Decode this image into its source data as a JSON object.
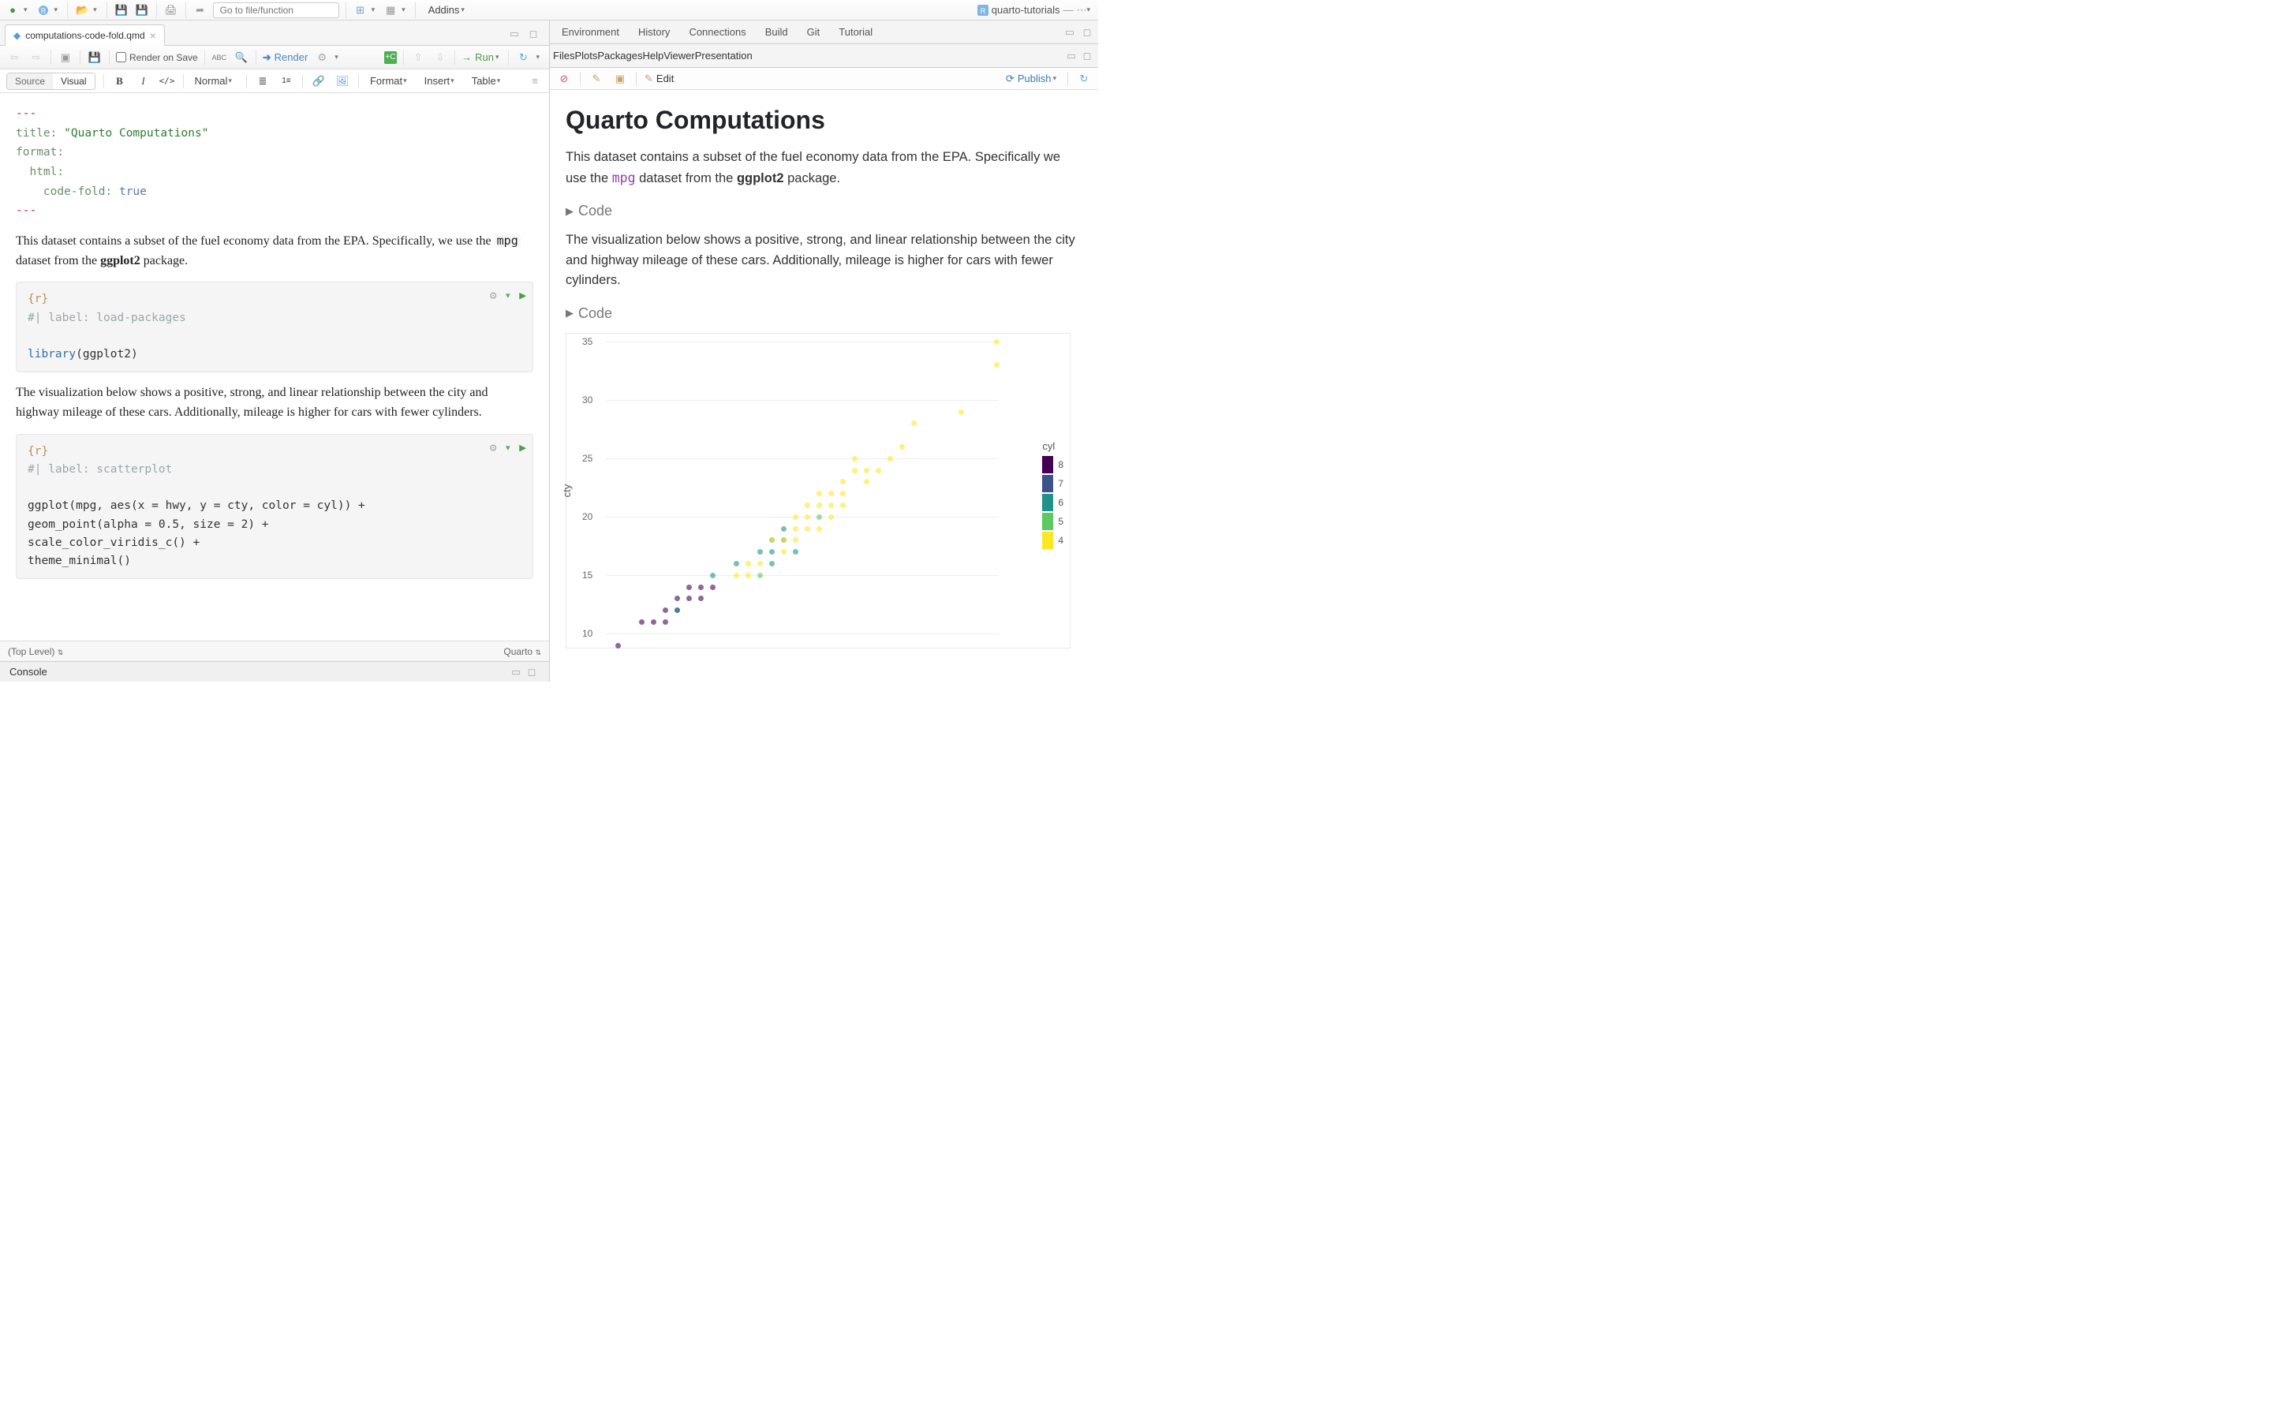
{
  "topbar": {
    "goto_placeholder": "Go to file/function",
    "addins_label": "Addins",
    "project_label": "quarto-tutorials"
  },
  "file_tab": "computations-code-fold.qmd",
  "toolbar1": {
    "render_on_save": "Render on Save",
    "render": "Render",
    "run": "Run"
  },
  "toolbar2": {
    "source": "Source",
    "visual": "Visual",
    "normal": "Normal",
    "format": "Format",
    "insert": "Insert",
    "table": "Table"
  },
  "yaml": {
    "fence": "---",
    "title_key": "title:",
    "title_val": "\"Quarto Computations\"",
    "format_key": "format:",
    "html_key": "html:",
    "codefold_key": "code-fold:",
    "codefold_val": "true"
  },
  "paras": {
    "p1_a": "This dataset contains a subset of the fuel economy data from the EPA. Specifically, we use the ",
    "p1_code": "mpg",
    "p1_b": " dataset from the ",
    "p1_strong": "ggplot2",
    "p1_c": " package.",
    "p2": "The visualization below shows a positive, strong, and linear relationship between the city and highway mileage of these cars. Additionally, mileage is higher for cars with fewer cylinders."
  },
  "chunk1": {
    "lang": "{r}",
    "comment": "#| label: load-packages",
    "line": [
      "library",
      "(ggplot2)"
    ]
  },
  "chunk2": {
    "lang": "{r}",
    "comment": "#| label: scatterplot",
    "l1": "ggplot(mpg, aes(x = hwy, y = cty, color = cyl)) +",
    "l2": "  geom_point(alpha = 0.5, size = 2) +",
    "l3": "  scale_color_viridis_c() +",
    "l4": "  theme_minimal()"
  },
  "statusbar": {
    "scope": "(Top Level)",
    "mode": "Quarto"
  },
  "console_label": "Console",
  "env_tabs": [
    "Environment",
    "History",
    "Connections",
    "Build",
    "Git",
    "Tutorial"
  ],
  "file_tabs": [
    "Files",
    "Plots",
    "Packages",
    "Help",
    "Viewer",
    "Presentation"
  ],
  "viewer_toolbar": {
    "edit": "Edit",
    "publish": "Publish"
  },
  "viewer": {
    "h1": "Quarto Computations",
    "p1_a": "This dataset contains a subset of the fuel economy data from the EPA. Specifically we use the ",
    "p1_code": "mpg",
    "p1_b": " dataset from the ",
    "p1_strong": "ggplot2",
    "p1_c": " package.",
    "code_fold": "Code",
    "p2": "The visualization below shows a positive, strong, and linear relationship between the city and highway mileage of these cars. Additionally, mileage is higher for cars with fewer cylinders."
  },
  "chart_data": {
    "type": "scatter",
    "xlabel": "",
    "ylabel": "cty",
    "ylim": [
      10,
      35
    ],
    "y_ticks": [
      10,
      15,
      20,
      25,
      30,
      35
    ],
    "color_var": "cyl",
    "color_range": [
      4,
      8
    ],
    "legend_ticks": [
      4,
      5,
      6,
      7,
      8
    ],
    "series": [
      {
        "hwy": 12,
        "cty": 9,
        "cyl": 8
      },
      {
        "hwy": 14,
        "cty": 11,
        "cyl": 8
      },
      {
        "hwy": 15,
        "cty": 11,
        "cyl": 8
      },
      {
        "hwy": 16,
        "cty": 11,
        "cyl": 8
      },
      {
        "hwy": 16,
        "cty": 12,
        "cyl": 8
      },
      {
        "hwy": 17,
        "cty": 12,
        "cyl": 8
      },
      {
        "hwy": 17,
        "cty": 12,
        "cyl": 6
      },
      {
        "hwy": 17,
        "cty": 13,
        "cyl": 8
      },
      {
        "hwy": 18,
        "cty": 13,
        "cyl": 8
      },
      {
        "hwy": 18,
        "cty": 14,
        "cyl": 8
      },
      {
        "hwy": 19,
        "cty": 13,
        "cyl": 8
      },
      {
        "hwy": 19,
        "cty": 14,
        "cyl": 8
      },
      {
        "hwy": 20,
        "cty": 14,
        "cyl": 8
      },
      {
        "hwy": 20,
        "cty": 15,
        "cyl": 6
      },
      {
        "hwy": 22,
        "cty": 15,
        "cyl": 4
      },
      {
        "hwy": 22,
        "cty": 16,
        "cyl": 6
      },
      {
        "hwy": 23,
        "cty": 15,
        "cyl": 4
      },
      {
        "hwy": 23,
        "cty": 16,
        "cyl": 4
      },
      {
        "hwy": 24,
        "cty": 15,
        "cyl": 5
      },
      {
        "hwy": 24,
        "cty": 17,
        "cyl": 6
      },
      {
        "hwy": 24,
        "cty": 16,
        "cyl": 4
      },
      {
        "hwy": 25,
        "cty": 16,
        "cyl": 6
      },
      {
        "hwy": 25,
        "cty": 17,
        "cyl": 6
      },
      {
        "hwy": 25,
        "cty": 18,
        "cyl": 6
      },
      {
        "hwy": 25,
        "cty": 18,
        "cyl": 4
      },
      {
        "hwy": 26,
        "cty": 17,
        "cyl": 4
      },
      {
        "hwy": 26,
        "cty": 18,
        "cyl": 6
      },
      {
        "hwy": 26,
        "cty": 18,
        "cyl": 4
      },
      {
        "hwy": 26,
        "cty": 19,
        "cyl": 6
      },
      {
        "hwy": 27,
        "cty": 17,
        "cyl": 6
      },
      {
        "hwy": 27,
        "cty": 18,
        "cyl": 4
      },
      {
        "hwy": 27,
        "cty": 19,
        "cyl": 4
      },
      {
        "hwy": 27,
        "cty": 20,
        "cyl": 4
      },
      {
        "hwy": 28,
        "cty": 19,
        "cyl": 4
      },
      {
        "hwy": 28,
        "cty": 20,
        "cyl": 4
      },
      {
        "hwy": 28,
        "cty": 21,
        "cyl": 4
      },
      {
        "hwy": 29,
        "cty": 19,
        "cyl": 4
      },
      {
        "hwy": 29,
        "cty": 20,
        "cyl": 5
      },
      {
        "hwy": 29,
        "cty": 21,
        "cyl": 4
      },
      {
        "hwy": 29,
        "cty": 22,
        "cyl": 4
      },
      {
        "hwy": 30,
        "cty": 20,
        "cyl": 4
      },
      {
        "hwy": 30,
        "cty": 21,
        "cyl": 4
      },
      {
        "hwy": 30,
        "cty": 22,
        "cyl": 4
      },
      {
        "hwy": 31,
        "cty": 21,
        "cyl": 4
      },
      {
        "hwy": 31,
        "cty": 22,
        "cyl": 4
      },
      {
        "hwy": 31,
        "cty": 23,
        "cyl": 4
      },
      {
        "hwy": 32,
        "cty": 24,
        "cyl": 4
      },
      {
        "hwy": 32,
        "cty": 25,
        "cyl": 4
      },
      {
        "hwy": 33,
        "cty": 23,
        "cyl": 4
      },
      {
        "hwy": 33,
        "cty": 24,
        "cyl": 4
      },
      {
        "hwy": 34,
        "cty": 24,
        "cyl": 4
      },
      {
        "hwy": 35,
        "cty": 25,
        "cyl": 4
      },
      {
        "hwy": 36,
        "cty": 26,
        "cyl": 4
      },
      {
        "hwy": 37,
        "cty": 28,
        "cyl": 4
      },
      {
        "hwy": 41,
        "cty": 29,
        "cyl": 4
      },
      {
        "hwy": 44,
        "cty": 33,
        "cyl": 4
      },
      {
        "hwy": 44,
        "cty": 35,
        "cyl": 4
      }
    ]
  }
}
